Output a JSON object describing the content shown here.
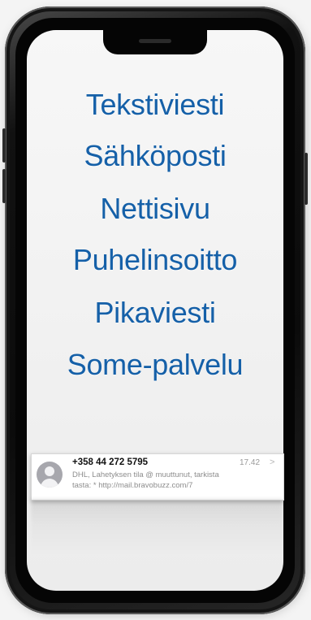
{
  "words": [
    "Tekstiviesti",
    "Sähköposti",
    "Nettisivu",
    "Puhelinsoitto",
    "Pikaviesti",
    "Some-palvelu"
  ],
  "message": {
    "sender": "+358 44 272 5795",
    "time": "17.42",
    "chevron": ">",
    "body_line1": "DHL, Lahetyksen tila @ muuttunut, tarkista",
    "body_line2": "tasta: * http://mail.bravobuzz.com/7"
  },
  "colors": {
    "word_text": "#1560a8",
    "phone_frame": "#111111",
    "screen_background": "#f1f1f1"
  },
  "icons": [
    "contact-avatar-icon",
    "chevron-right-icon"
  ]
}
